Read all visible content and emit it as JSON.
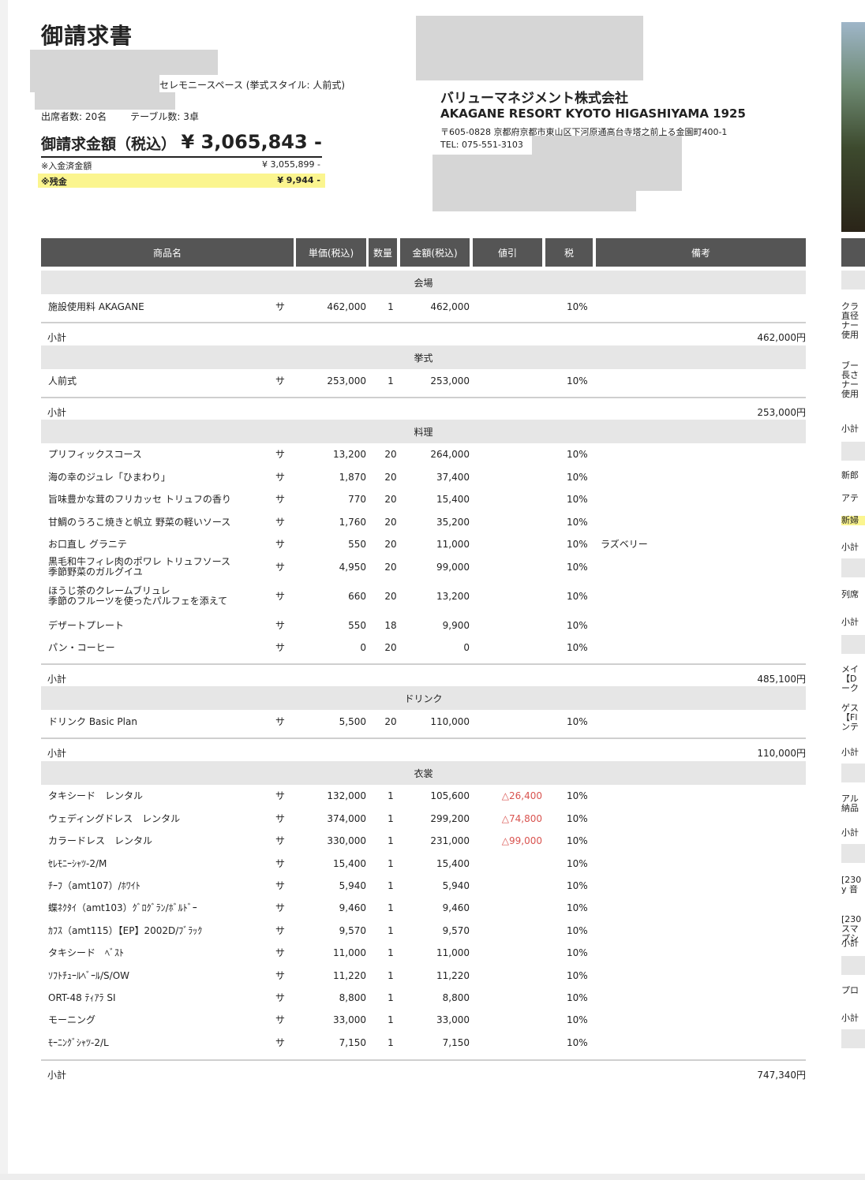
{
  "header": {
    "title": "御請求書",
    "venue": "セレモニースペース (挙式スタイル: 人前式)",
    "attendees": "出席者数: 20名",
    "tables": "テーブル数: 3卓",
    "total_label": "御請求金額（税込）",
    "total_value": "¥ 3,065,843 -",
    "paid_label": "※入金済金額",
    "paid_value": "¥ 3,055,899 -",
    "balance_label": "※残金",
    "balance_value": "¥ 9,944 -"
  },
  "issuer": {
    "company": "バリューマネジメント株式会社",
    "resort": "AKAGANE RESORT KYOTO HIGASHIYAMA 1925",
    "address": "〒605-0828 京都府京都市東山区下河原通高台寺塔之前上る金園町400-1",
    "tel": "TEL: 075-551-3103"
  },
  "columns": [
    "商品名",
    "単価(税込)",
    "数量",
    "金額(税込)",
    "値引",
    "税",
    "備考"
  ],
  "subtotal_label": "小計",
  "sections": [
    {
      "category": "会場",
      "items": [
        {
          "name": "施設使用料 AKAGANE",
          "mark": "サ",
          "unit": "462,000",
          "qty": "1",
          "amount": "462,000",
          "discount": "",
          "tax": "10%",
          "note": ""
        }
      ],
      "subtotal": "462,000円"
    },
    {
      "category": "挙式",
      "items": [
        {
          "name": "人前式",
          "mark": "サ",
          "unit": "253,000",
          "qty": "1",
          "amount": "253,000",
          "discount": "",
          "tax": "10%",
          "note": ""
        }
      ],
      "subtotal": "253,000円"
    },
    {
      "category": "料理",
      "items": [
        {
          "name": "プリフィックスコース",
          "mark": "サ",
          "unit": "13,200",
          "qty": "20",
          "amount": "264,000",
          "discount": "",
          "tax": "10%",
          "note": ""
        },
        {
          "name": "海の幸のジュレ「ひまわり」",
          "mark": "サ",
          "unit": "1,870",
          "qty": "20",
          "amount": "37,400",
          "discount": "",
          "tax": "10%",
          "note": ""
        },
        {
          "name": "旨味豊かな茸のフリカッセ トリュフの香り",
          "mark": "サ",
          "unit": "770",
          "qty": "20",
          "amount": "15,400",
          "discount": "",
          "tax": "10%",
          "note": ""
        },
        {
          "name": "甘鯛のうろこ焼きと帆立 野菜の軽いソース",
          "mark": "サ",
          "unit": "1,760",
          "qty": "20",
          "amount": "35,200",
          "discount": "",
          "tax": "10%",
          "note": ""
        },
        {
          "name": "お口直し グラニテ",
          "mark": "サ",
          "unit": "550",
          "qty": "20",
          "amount": "11,000",
          "discount": "",
          "tax": "10%",
          "note": "ラズベリー"
        },
        {
          "name": "黒毛和牛フィレ肉のポワレ トリュフソース",
          "name2": "季節野菜のガルグイユ",
          "mark": "サ",
          "unit": "4,950",
          "qty": "20",
          "amount": "99,000",
          "discount": "",
          "tax": "10%",
          "note": ""
        },
        {
          "name": "ほうじ茶のクレームブリュレ",
          "name2": "季節のフルーツを使ったパルフェを添えて",
          "mark": "サ",
          "unit": "660",
          "qty": "20",
          "amount": "13,200",
          "discount": "",
          "tax": "10%",
          "note": ""
        },
        {
          "name": "デザートプレート",
          "mark": "サ",
          "unit": "550",
          "qty": "18",
          "amount": "9,900",
          "discount": "",
          "tax": "10%",
          "note": ""
        },
        {
          "name": "パン・コーヒー",
          "mark": "サ",
          "unit": "0",
          "qty": "20",
          "amount": "0",
          "discount": "",
          "tax": "10%",
          "note": ""
        }
      ],
      "subtotal": "485,100円"
    },
    {
      "category": "ドリンク",
      "items": [
        {
          "name": "ドリンク Basic Plan",
          "mark": "サ",
          "unit": "5,500",
          "qty": "20",
          "amount": "110,000",
          "discount": "",
          "tax": "10%",
          "note": ""
        }
      ],
      "subtotal": "110,000円"
    },
    {
      "category": "衣裳",
      "items": [
        {
          "name": "タキシード　レンタル",
          "mark": "サ",
          "unit": "132,000",
          "qty": "1",
          "amount": "105,600",
          "discount": "△26,400",
          "tax": "10%",
          "note": ""
        },
        {
          "name": "ウェディングドレス　レンタル",
          "mark": "サ",
          "unit": "374,000",
          "qty": "1",
          "amount": "299,200",
          "discount": "△74,800",
          "tax": "10%",
          "note": ""
        },
        {
          "name": "カラードレス　レンタル",
          "mark": "サ",
          "unit": "330,000",
          "qty": "1",
          "amount": "231,000",
          "discount": "△99,000",
          "tax": "10%",
          "note": ""
        },
        {
          "name": "ｾﾚﾓﾆｰｼｬﾂ-2/M",
          "mark": "サ",
          "unit": "15,400",
          "qty": "1",
          "amount": "15,400",
          "discount": "",
          "tax": "10%",
          "note": ""
        },
        {
          "name": "ﾁｰﾌ（amt107）/ﾎﾜｲﾄ",
          "mark": "サ",
          "unit": "5,940",
          "qty": "1",
          "amount": "5,940",
          "discount": "",
          "tax": "10%",
          "note": ""
        },
        {
          "name": "蝶ﾈｸﾀｲ（amt103）ｸﾞﾛｸﾞﾗﾝ/ﾎﾞﾙﾄﾞｰ",
          "mark": "サ",
          "unit": "9,460",
          "qty": "1",
          "amount": "9,460",
          "discount": "",
          "tax": "10%",
          "note": ""
        },
        {
          "name": "ｶﾌｽ（amt115）【EP】2002D/ﾌﾞﾗｯｸ",
          "mark": "サ",
          "unit": "9,570",
          "qty": "1",
          "amount": "9,570",
          "discount": "",
          "tax": "10%",
          "note": ""
        },
        {
          "name": "タキシード　ﾍﾞｽﾄ",
          "mark": "サ",
          "unit": "11,000",
          "qty": "1",
          "amount": "11,000",
          "discount": "",
          "tax": "10%",
          "note": ""
        },
        {
          "name": "ｿﾌﾄﾁｭｰﾙﾍﾞｰﾙ/S/OW",
          "mark": "サ",
          "unit": "11,220",
          "qty": "1",
          "amount": "11,220",
          "discount": "",
          "tax": "10%",
          "note": ""
        },
        {
          "name": "ORT-48 ﾃｨｱﾗ SI",
          "mark": "サ",
          "unit": "8,800",
          "qty": "1",
          "amount": "8,800",
          "discount": "",
          "tax": "10%",
          "note": ""
        },
        {
          "name": "モーニング",
          "mark": "サ",
          "unit": "33,000",
          "qty": "1",
          "amount": "33,000",
          "discount": "",
          "tax": "10%",
          "note": ""
        },
        {
          "name": "ﾓｰﾆﾝｸﾞｼｬﾂ-2/L",
          "mark": "サ",
          "unit": "7,150",
          "qty": "1",
          "amount": "7,150",
          "discount": "",
          "tax": "10%",
          "note": ""
        }
      ],
      "subtotal": "747,340円"
    }
  ],
  "right_strip": [
    "クラ",
    "直径",
    "ナー",
    "使用",
    "ブー",
    "長さ",
    "ナー",
    "使用",
    "小計",
    "新郎",
    "アテ",
    "新婦",
    "小計",
    "列席",
    "小計",
    "メイ",
    "【D",
    "ーク",
    "ゲス",
    "【Fl",
    "ンテ",
    "小計",
    "アル",
    "納品",
    "小計",
    "[230",
    "y 音",
    "[230",
    "スマ",
    "プシ",
    "小計",
    "プロ",
    "小計"
  ]
}
